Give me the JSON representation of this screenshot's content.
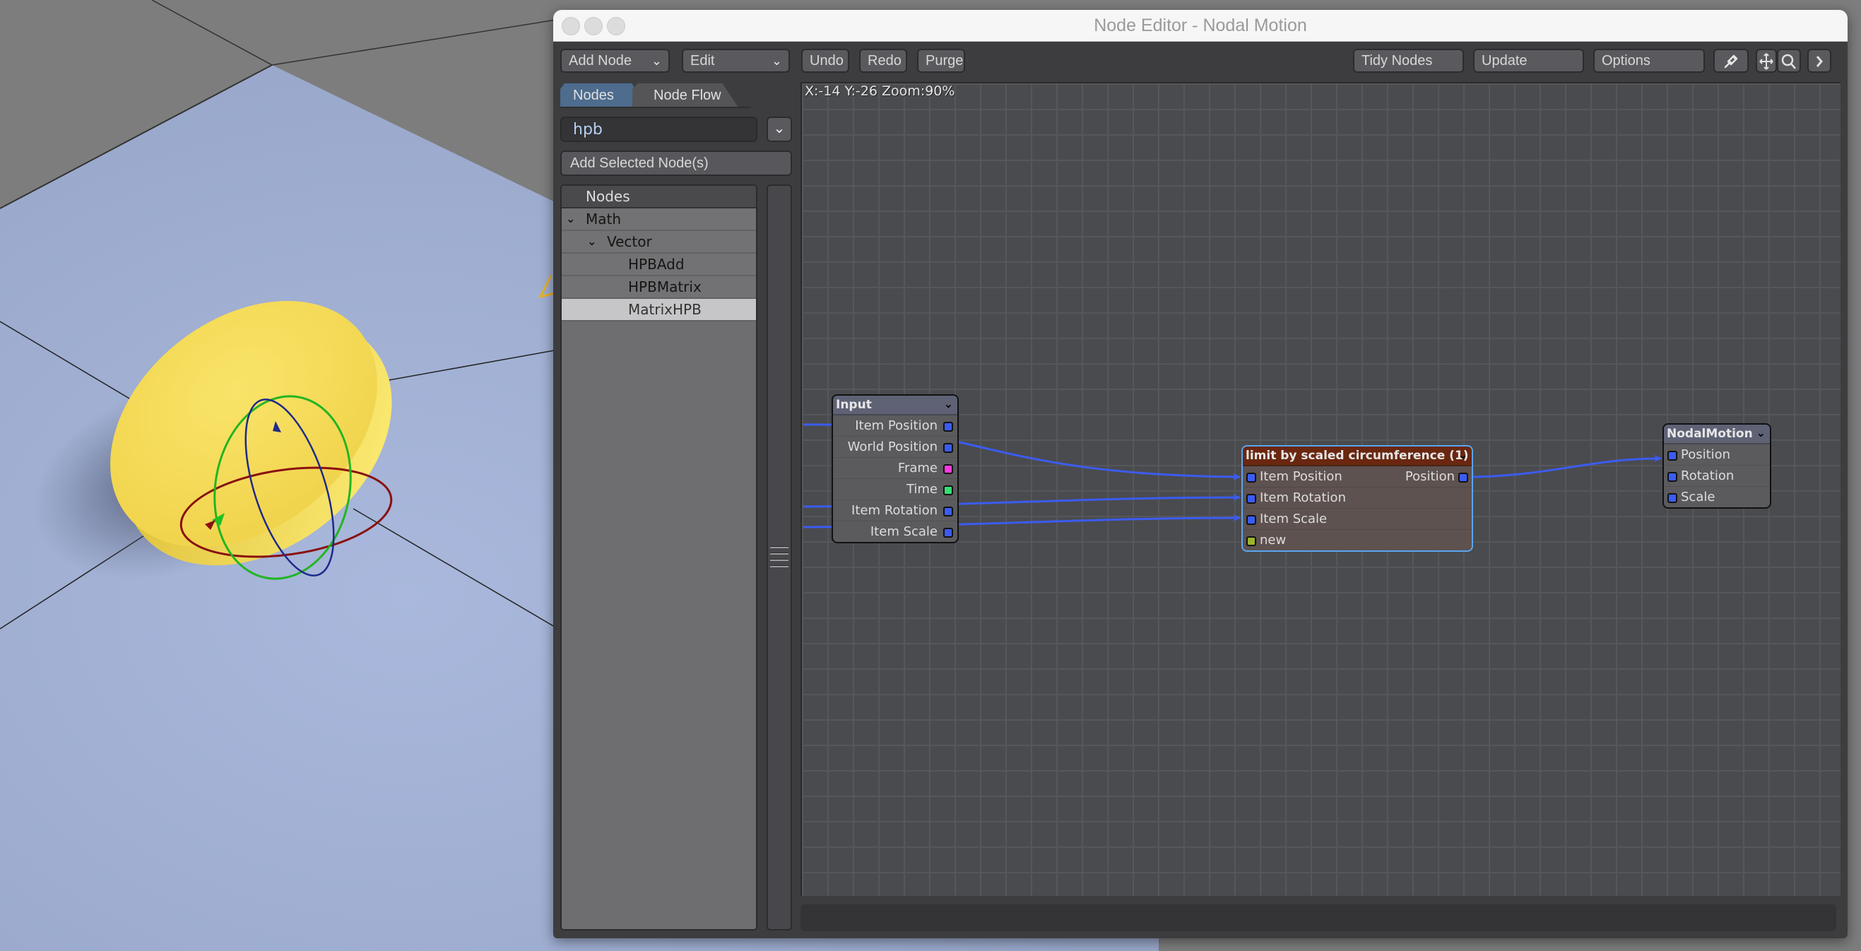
{
  "window": {
    "title": "Node Editor - Nodal Motion"
  },
  "toolbar": {
    "add_node": "Add Node",
    "edit": "Edit",
    "undo": "Undo",
    "redo": "Redo",
    "purge": "Purge",
    "tidy_nodes": "Tidy Nodes",
    "update": "Update",
    "options": "Options",
    "icons": [
      "pin-icon",
      "move-icon",
      "search-icon",
      "chevron-right-icon"
    ]
  },
  "tabs": [
    {
      "label": "Nodes",
      "active": true
    },
    {
      "label": "Node Flow",
      "active": false
    }
  ],
  "search": {
    "value": "hpb"
  },
  "add_selected_label": "Add Selected Node(s)",
  "tree": {
    "header": "Nodes",
    "items": [
      {
        "label": "Math",
        "level": 0,
        "expanded": true
      },
      {
        "label": "Vector",
        "level": 1,
        "expanded": true
      },
      {
        "label": "HPBAdd",
        "level": 2
      },
      {
        "label": "HPBMatrix",
        "level": 2
      },
      {
        "label": "MatrixHPB",
        "level": 2,
        "selected": true
      }
    ]
  },
  "canvas": {
    "status": "X:-14 Y:-26 Zoom:90%"
  },
  "colors": {
    "port_vector": "#3a5cf5",
    "port_integer": "#ff38e0",
    "port_scalar": "#35e070",
    "port_function": "#9ab52a",
    "wire": "#3b5cf2",
    "selected_node_border": "#5aa6f0",
    "compound_node_header": "#6a2710"
  },
  "nodes": {
    "input": {
      "title": "Input",
      "outputs": [
        {
          "label": "Item Position",
          "type": "vector"
        },
        {
          "label": "World Position",
          "type": "vector"
        },
        {
          "label": "Frame",
          "type": "integer"
        },
        {
          "label": "Time",
          "type": "scalar"
        },
        {
          "label": "Item Rotation",
          "type": "vector"
        },
        {
          "label": "Item Scale",
          "type": "vector"
        }
      ]
    },
    "limit": {
      "title": "limit by scaled circumference (1)",
      "inputs": [
        {
          "label": "Item Position",
          "type": "vector"
        },
        {
          "label": "Item Rotation",
          "type": "vector"
        },
        {
          "label": "Item Scale",
          "type": "vector"
        },
        {
          "label": "new",
          "type": "function"
        }
      ],
      "outputs": [
        {
          "label": "Position",
          "type": "vector"
        }
      ]
    },
    "nodal_motion": {
      "title": "NodalMotion",
      "inputs": [
        {
          "label": "Position",
          "type": "vector"
        },
        {
          "label": "Rotation",
          "type": "vector"
        },
        {
          "label": "Scale",
          "type": "vector"
        }
      ]
    }
  },
  "connections": [
    {
      "from": "input.Item Position",
      "to": "limit.Item Position"
    },
    {
      "from": "input.Item Rotation",
      "to": "limit.Item Rotation"
    },
    {
      "from": "input.Item Scale",
      "to": "limit.Item Scale"
    },
    {
      "from": "limit.Position",
      "to": "nodal_motion.Position"
    }
  ]
}
